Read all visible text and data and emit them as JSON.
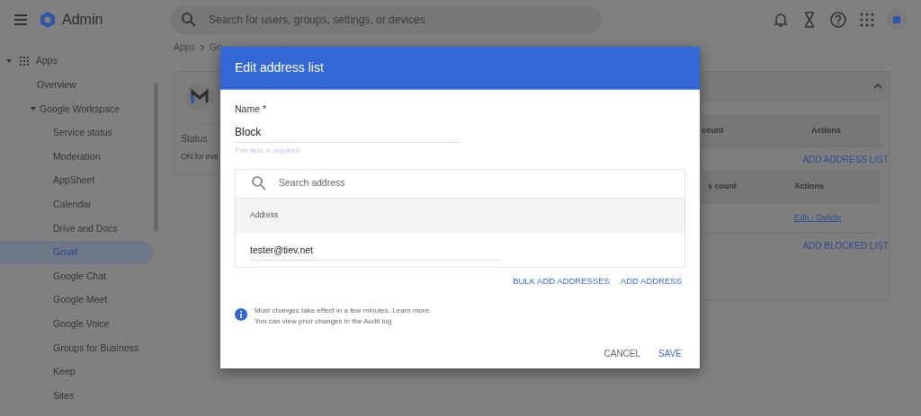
{
  "topbar": {
    "app_title": "Admin",
    "search": {
      "placeholder": "Search for users, groups, settings, or devices"
    }
  },
  "sidebar": {
    "items": [
      {
        "label": "Apps",
        "selected": false,
        "expanded": true,
        "children": [
          {
            "label": "Overview",
            "selected": false
          },
          {
            "label": "Google Workspace",
            "selected": false,
            "expanded": true,
            "children": [
              {
                "label": "Service status",
                "selected": false
              },
              {
                "label": "Moderation",
                "selected": false
              },
              {
                "label": "AppSheet",
                "selected": false
              },
              {
                "label": "Calendar",
                "selected": false
              },
              {
                "label": "Drive and Docs",
                "selected": false
              },
              {
                "label": "Gmail",
                "selected": true
              },
              {
                "label": "Google Chat",
                "selected": false
              },
              {
                "label": "Google Meet",
                "selected": false
              },
              {
                "label": "Google Voice",
                "selected": false
              },
              {
                "label": "Groups for Business",
                "selected": false
              },
              {
                "label": "Keep",
                "selected": false
              },
              {
                "label": "Sites",
                "selected": false
              }
            ]
          }
        ]
      }
    ]
  },
  "breadcrumb": [
    "Apps",
    "Go"
  ],
  "app_card": {
    "status_label": "Status",
    "status_value": "ON for eve"
  },
  "settings_panel": {
    "expanded": true,
    "tables": [
      {
        "columns": [
          "count",
          "Actions"
        ],
        "add_button": "ADD ADDRESS LIST"
      },
      {
        "columns": [
          "s count",
          "Actions"
        ],
        "rows": [
          {
            "actions": "Edit - Delete"
          }
        ],
        "add_button": "ADD BLOCKED LIST"
      }
    ]
  },
  "dialog": {
    "title": "Edit address list",
    "name_field": {
      "label": "Name *",
      "value": "Block",
      "hint": "This field is required."
    },
    "address_search": {
      "placeholder": "Search address"
    },
    "address_table": {
      "column": "Address",
      "rows": [
        {
          "value": "tester@tiev.net"
        }
      ]
    },
    "list_actions": [
      "BULK ADD ADDRESSES",
      "ADD ADDRESS"
    ],
    "info": {
      "line_1": "Most changes take effect in a few minutes.",
      "link_1": "Learn more",
      "line_2": "You can view prior changes in the",
      "link_2": "Audit log"
    },
    "footer_buttons": [
      {
        "label": "CANCEL",
        "kind": "secondary"
      },
      {
        "label": "SAVE",
        "kind": "primary"
      }
    ]
  }
}
